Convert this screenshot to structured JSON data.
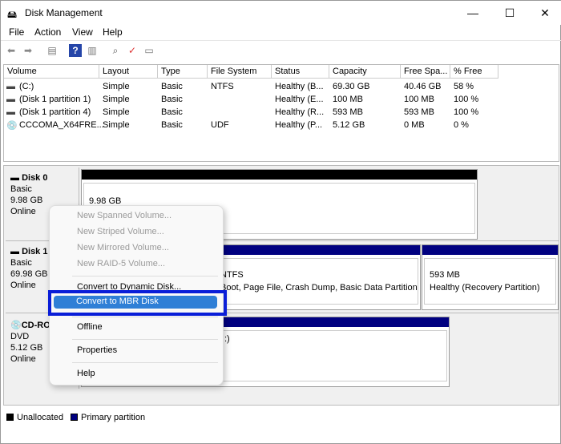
{
  "window": {
    "title": "Disk Management",
    "minimize": "—",
    "maximize": "☐",
    "close": "✕"
  },
  "menubar": [
    "File",
    "Action",
    "View",
    "Help"
  ],
  "toolbar": [
    "back-icon",
    "forward-icon",
    "console-tree-icon",
    "help-icon",
    "action-pane-icon",
    "connect-icon",
    "check-icon",
    "properties-icon"
  ],
  "table": {
    "headers": [
      "Volume",
      "Layout",
      "Type",
      "File System",
      "Status",
      "Capacity",
      "Free Spa...",
      "% Free"
    ],
    "rows": [
      [
        "(C:)",
        "Simple",
        "Basic",
        "NTFS",
        "Healthy (B...",
        "69.30 GB",
        "40.46 GB",
        "58 %"
      ],
      [
        "(Disk 1 partition 1)",
        "Simple",
        "Basic",
        "",
        "Healthy (E...",
        "100 MB",
        "100 MB",
        "100 %"
      ],
      [
        "(Disk 1 partition 4)",
        "Simple",
        "Basic",
        "",
        "Healthy (R...",
        "593 MB",
        "593 MB",
        "100 %"
      ],
      [
        "CCCOMA_X64FRE...",
        "Simple",
        "Basic",
        "UDF",
        "Healthy (P...",
        "5.12 GB",
        "0 MB",
        "0 %"
      ]
    ]
  },
  "disks": [
    {
      "name": "Disk 0",
      "type": "Basic",
      "size": "9.98 GB",
      "status": "Online",
      "partitions": [
        {
          "line1": "9.98 GB",
          "line2": ""
        }
      ]
    },
    {
      "name": "Disk 1",
      "type": "Basic",
      "size": "69.98 GB",
      "status": "Online",
      "partitions": [
        {
          "line1": "NTFS",
          "line2": "Boot, Page File, Crash Dump, Basic Data Partition"
        },
        {
          "line1": "593 MB",
          "line2": "Healthy (Recovery Partition)"
        }
      ]
    },
    {
      "name": "CD-ROM",
      "type": "DVD",
      "size": "5.12 GB",
      "status": "Online",
      "partitions": [
        {
          "line1": ":)",
          "line2": ""
        }
      ]
    }
  ],
  "legend": [
    {
      "label": "Unallocated",
      "color": "#000000"
    },
    {
      "label": "Primary partition",
      "color": "#000080"
    }
  ],
  "context_menu": {
    "items": [
      "New Spanned Volume...",
      "New Striped Volume...",
      "New Mirrored Volume...",
      "New RAID-5 Volume...",
      "Convert to Dynamic Disk...",
      "Convert to MBR Disk",
      "Offline",
      "Properties",
      "Help"
    ],
    "highlighted": "Convert to MBR Disk"
  },
  "colors": {
    "primary": "#000080",
    "unallocated": "#000000",
    "highlight": "#2f7fd6",
    "annotation": "#0a1ed8"
  }
}
